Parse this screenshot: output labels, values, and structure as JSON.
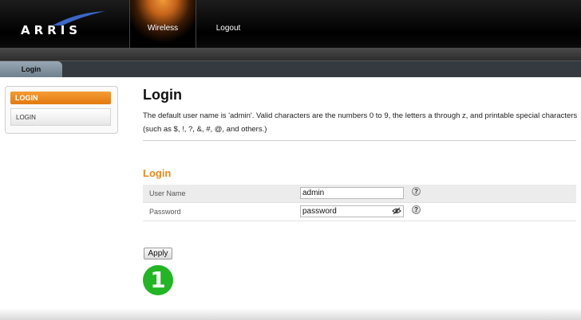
{
  "header": {
    "logo_text": "ARRIS",
    "nav": [
      {
        "label": "Wireless",
        "active": true
      },
      {
        "label": "Logout",
        "active": false
      }
    ]
  },
  "subnav": {
    "tab_label": "Login"
  },
  "sidebar": {
    "active_label": "LOGIN",
    "items": [
      {
        "label": "LOGIN"
      }
    ]
  },
  "main": {
    "title": "Login",
    "description": "The default user name is 'admin'. Valid characters are the numbers 0 to 9, the letters a through z, and printable special characters (such as $, !, ?, &, #, @, and others.)",
    "section_title": "Login",
    "fields": {
      "username": {
        "label": "User Name",
        "value": "admin"
      },
      "password": {
        "label": "Password",
        "value": "password"
      }
    },
    "help_glyph": "?",
    "apply_label": "Apply",
    "step_badge": "1"
  },
  "colors": {
    "accent": "#e88a1e",
    "step_green": "#22b524"
  },
  "icons": [
    "arris-swoosh-icon",
    "eye-slash-icon",
    "help-icon"
  ]
}
